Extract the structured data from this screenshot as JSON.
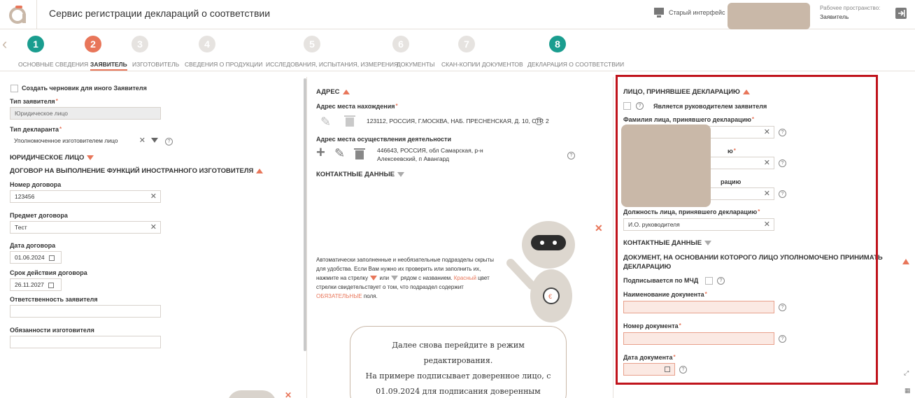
{
  "header": {
    "title": "Сервис регистрации деклараций о соответствии",
    "old_ui": "Старый интерфейс",
    "workspace_label": "Рабочее пространство:",
    "workspace_value": "Заявитель"
  },
  "steps": [
    {
      "num": "1",
      "label": "ОСНОВНЫЕ СВЕДЕНИЯ",
      "color": "#1a9d8f"
    },
    {
      "num": "2",
      "label": "ЗАЯВИТЕЛЬ",
      "color": "#e8765a",
      "active": true
    },
    {
      "num": "3",
      "label": "ИЗГОТОВИТЕЛЬ",
      "color": "#e6e3e0"
    },
    {
      "num": "4",
      "label": "СВЕДЕНИЯ О ПРОДУКЦИИ",
      "color": "#e6e3e0"
    },
    {
      "num": "5",
      "label": "ИССЛЕДОВАНИЯ, ИСПЫТАНИЯ, ИЗМЕРЕНИЯ",
      "color": "#e6e3e0"
    },
    {
      "num": "6",
      "label": "ДОКУМЕНТЫ",
      "color": "#e6e3e0"
    },
    {
      "num": "7",
      "label": "СКАН-КОПИИ ДОКУМЕНТОВ",
      "color": "#e6e3e0"
    },
    {
      "num": "8",
      "label": "ДЕКЛАРАЦИЯ О СООТВЕТСТВИИ",
      "color": "#1a9d8f"
    }
  ],
  "left": {
    "draft_checkbox": "Создать черновик для иного Заявителя",
    "applicant_type_label": "Тип заявителя",
    "applicant_type_value": "Юридическое лицо",
    "declarant_type_label": "Тип декларанта",
    "declarant_type_value": "Уполномоченное изготовителем лицо",
    "legal_entity_section": "ЮРИДИЧЕСКОЕ ЛИЦО",
    "contract_section": "ДОГОВОР НА ВЫПОЛНЕНИЕ ФУНКЦИЙ ИНОСТРАННОГО ИЗГОТОВИТЕЛЯ",
    "contract_number_label": "Номер договора",
    "contract_number_value": "123456",
    "contract_subject_label": "Предмет договора",
    "contract_subject_value": "Тест",
    "contract_date_label": "Дата договора",
    "contract_date_value": "01.06.2024",
    "contract_term_label": "Срок действия договора",
    "contract_term_value": "26.11.2027",
    "applicant_resp_label": "Ответственность заявителя",
    "applicant_resp_value": "",
    "manufacturer_duties_label": "Обязанности изготовителя",
    "manufacturer_duties_value": ""
  },
  "middle": {
    "address_section": "АДРЕС",
    "location_label": "Адрес места нахождения",
    "location_value": "123112, РОССИЯ, Г.МОСКВА, НАБ. ПРЕСНЕНСКАЯ, Д. 10, СТР. 2",
    "activity_label": "Адрес места осуществления деятельности",
    "activity_value_1": "446643, РОССИЯ, обл Самарская, р-н",
    "activity_value_2": "Алексеевский, п Авангард",
    "contacts_section": "КОНТАКТНЫЕ ДАННЫЕ",
    "hint_1": "Автоматически заполненные и необязательные подразделы скрыты",
    "hint_2": "для удобства. Если Вам нужно их проверить или заполнить их,",
    "hint_3a": "нажмите на стрелку",
    "hint_3b": "или",
    "hint_3c": "рядом с названием.",
    "hint_3d": "Красный",
    "hint_3e": "цвет",
    "hint_4": "стрелки свидетельствует о том, что подраздел содержит",
    "hint_5a": "ОБЯЗАТЕЛЬНЫЕ",
    "hint_5b": "поля.",
    "bubble_1": "Далее снова перейдите в режим",
    "bubble_2": "редактирования.",
    "bubble_3": "На примере подписывает доверенное лицо, с",
    "bubble_4": "01.09.2024 для подписания доверенным"
  },
  "right": {
    "person_section": "ЛИЦО, ПРИНЯВШЕЕ ДЕКЛАРАЦИЮ",
    "is_head_label": "Является руководителем заявителя",
    "surname_label": "Фамилия лица, принявшего декларацию",
    "name_label_tail": "ю",
    "patronymic_label_tail": "рацию",
    "position_label": "Должность лица, принявшего декларацию",
    "position_value": "И.О. руководителя",
    "contacts_section": "КОНТАКТНЫЕ ДАННЫЕ",
    "doc_section_1": "ДОКУМЕНТ, НА ОСНОВАНИИ КОТОРОГО ЛИЦО УПОЛНОМОЧЕНО ПРИНИМАТЬ",
    "doc_section_2": "ДЕКЛАРАЦИЮ",
    "mchd_label": "Подписывается по МЧД",
    "doc_name_label": "Наименование документа",
    "doc_number_label": "Номер документа",
    "doc_date_label": "Дата документа"
  },
  "colors": {
    "accent": "#e8765a",
    "teal": "#1a9d8f",
    "highlight": "#c0141c",
    "redaction": "#c9b8a8"
  }
}
